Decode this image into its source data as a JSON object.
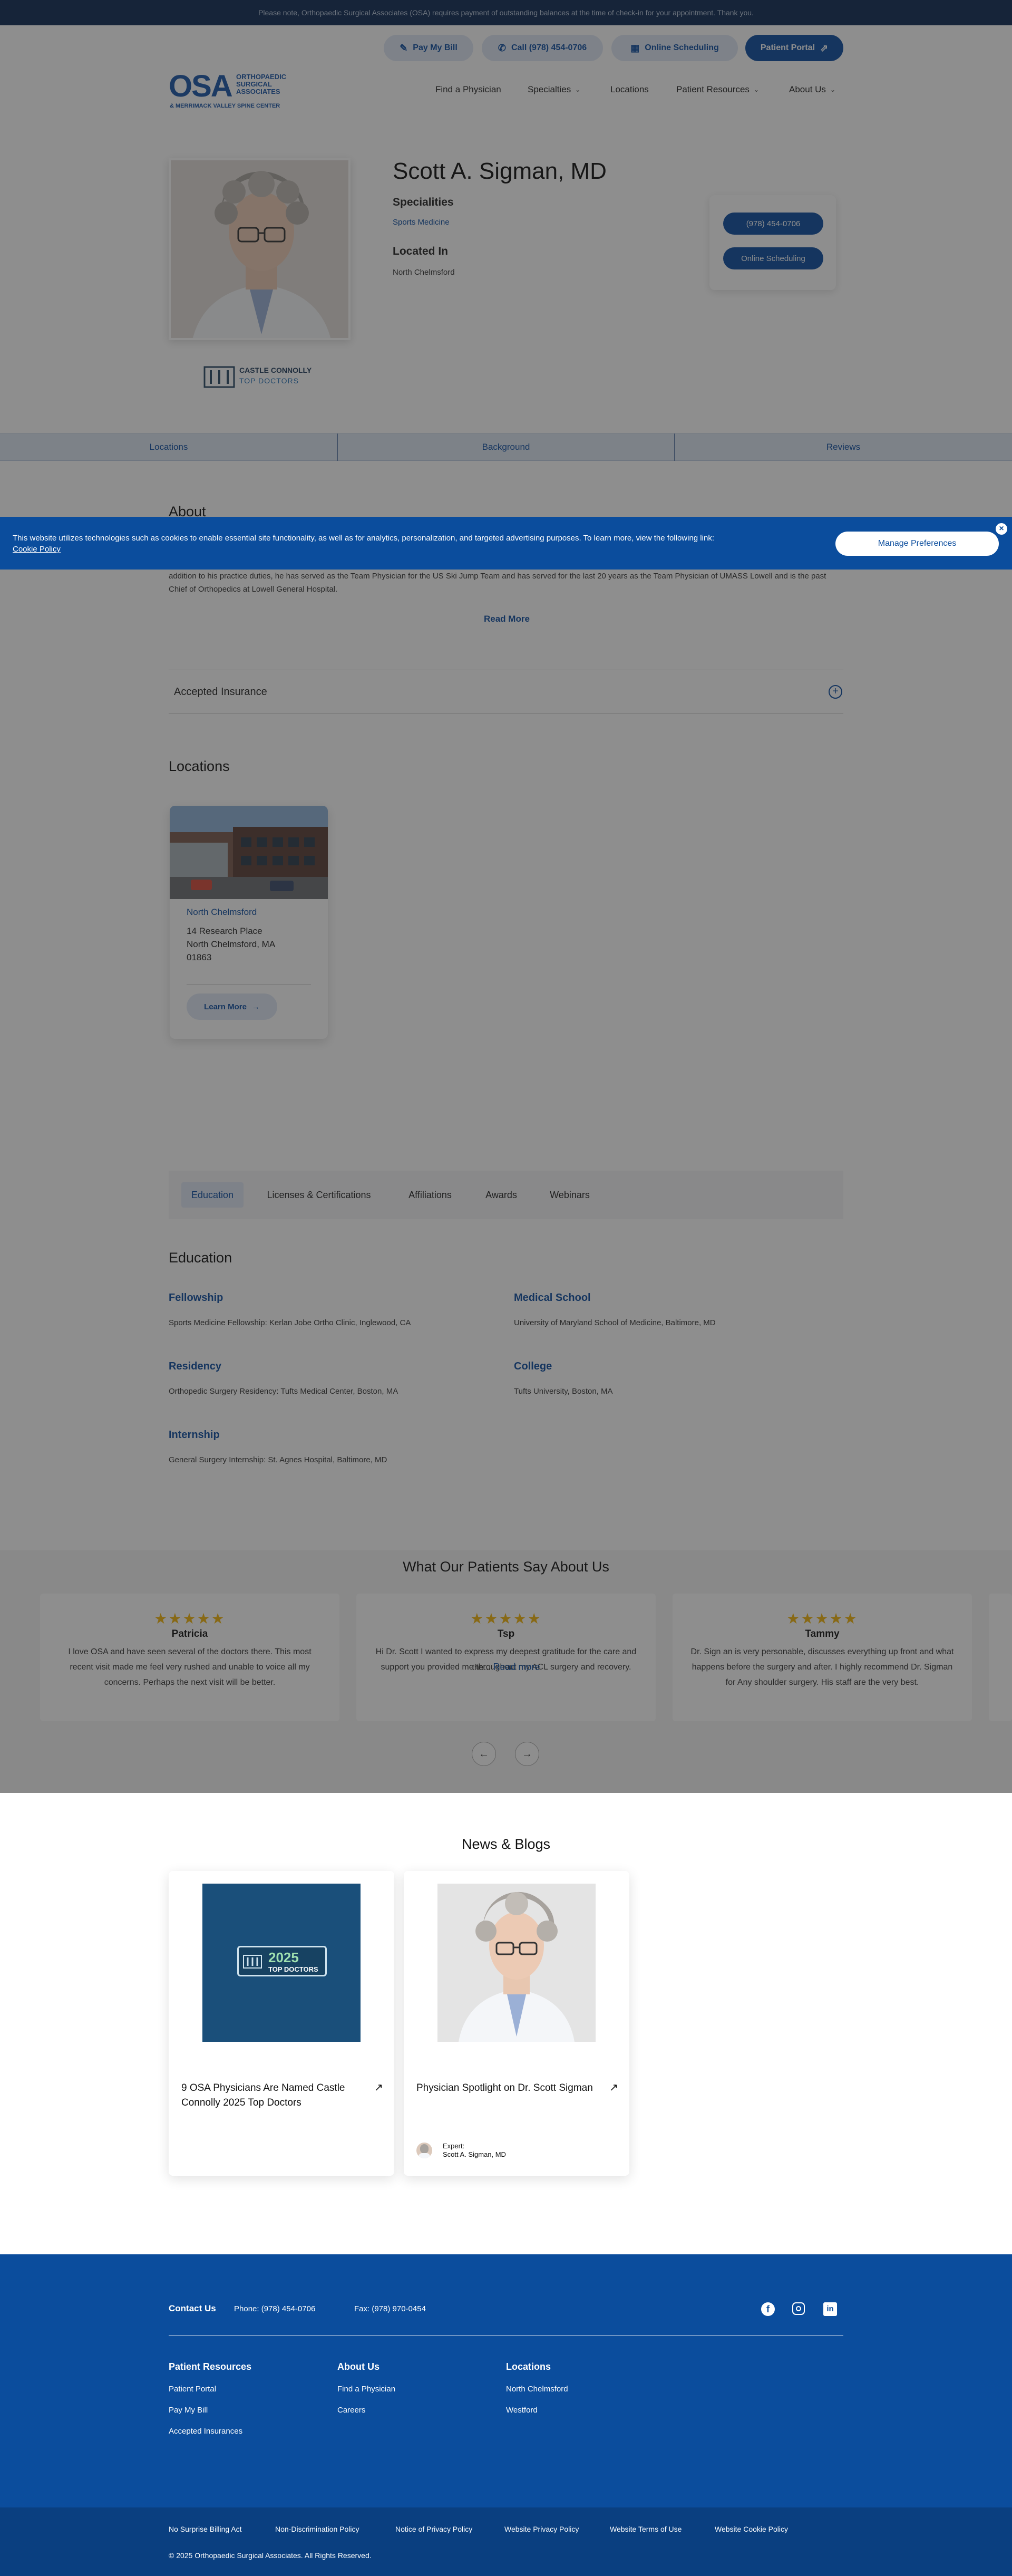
{
  "notice": {
    "text": "Please note, Orthopaedic Surgical Associates (OSA) requires payment of outstanding balances at the time of check-in for your appointment. Thank you."
  },
  "utility": {
    "pay_bill": "Pay My Bill",
    "call": "Call (978) 454-0706",
    "schedule": "Online Scheduling",
    "portal": "Patient Portal"
  },
  "logo": {
    "mark": "OSA",
    "name": "ORTHOPAEDIC SURGICAL ASSOCIATES",
    "tagline": "& MERRIMACK VALLEY SPINE CENTER"
  },
  "nav": {
    "items": [
      "Find a Physician",
      "Specialties",
      "Locations",
      "Patient Resources",
      "About Us"
    ]
  },
  "profile": {
    "name": "Scott A. Sigman, MD",
    "specialties_label": "Specialities",
    "specialty": "Sports Medicine",
    "located_label": "Located In",
    "location": "North Chelmsford",
    "phone_button": "(978) 454-0706",
    "schedule_button": "Online Scheduling",
    "award_line1": "CASTLE CONNOLLY",
    "award_line2": "TOP DOCTORS"
  },
  "tabs": [
    "Locations",
    "Background",
    "Reviews"
  ],
  "about": {
    "title": "About",
    "text": "addition to his practice duties, he has served as the Team Physician for the US Ski Jump Team and has served for the last 20 years as the Team Physician of UMASS Lowell and is the past Chief of Orthopedics at Lowell General Hospital.",
    "read_more": "Read More",
    "insurance": "Accepted Insurance"
  },
  "locations": {
    "title": "Locations",
    "card": {
      "name": "North Chelmsford",
      "line1": "14 Research Place",
      "line2": "North Chelmsford, MA",
      "line3": "01863",
      "button": "Learn More"
    }
  },
  "background": {
    "tabs": [
      "Education",
      "Licenses & Certifications",
      "Affiliations",
      "Awards",
      "Webinars"
    ],
    "title": "Education",
    "items": [
      {
        "heading": "Fellowship",
        "value": "Sports Medicine Fellowship: Kerlan Jobe Ortho Clinic, Inglewood, CA"
      },
      {
        "heading": "Medical School",
        "value": "University of Maryland School of Medicine, Baltimore, MD"
      },
      {
        "heading": "Residency",
        "value": "Orthopedic Surgery Residency: Tufts Medical Center, Boston, MA"
      },
      {
        "heading": "College",
        "value": "Tufts University, Boston, MA"
      },
      {
        "heading": "Internship",
        "value": "General Surgery Internship: St. Agnes Hospital, Baltimore, MD"
      }
    ]
  },
  "testimonials": {
    "title": "What Our Patients Say About Us",
    "stars": "★★★★★",
    "items": [
      {
        "name": "Patricia",
        "text": "I love OSA and have seen several of the doctors there. This most recent visit made me feel very rushed and unable to voice all my concerns. Perhaps the next visit will be better."
      },
      {
        "name": "Tsp",
        "text": "Hi Dr. Scott I wanted to express my deepest gratitude for the care and support you provided me throughout my ACL surgery and recovery. First I was so worry because is a revision ACL, you took the...",
        "more": "Read more"
      },
      {
        "name": "Tammy",
        "text": "Dr. Sign an is very personable, discusses everything up front and what happens before the surgery and after. I highly recommend Dr. Sigman for Any shoulder surgery. His staff are the very best."
      }
    ]
  },
  "news": {
    "title": "News & Blogs",
    "items": [
      {
        "title": "9 OSA Physicians Are Named Castle Connolly 2025 Top Doctors",
        "badge_year": "2025",
        "badge_text": "TOP DOCTORS"
      },
      {
        "title": "Physician Spotlight on Dr. Scott Sigman",
        "expert_label": "Expert:",
        "expert_name": "Scott A. Sigman, MD"
      }
    ]
  },
  "cookie": {
    "text": "This website utilizes technologies such as cookies to enable essential site functionality, as well as for analytics, personalization, and targeted advertising purposes. To learn more, view the following link:",
    "link": "Cookie Policy",
    "button": "Manage Preferences"
  },
  "footer": {
    "contact_title": "Contact Us",
    "phone": "Phone: (978) 454-0706",
    "fax": "Fax: (978) 970-0454",
    "columns": [
      {
        "title": "Patient Resources",
        "links": [
          "Patient Portal",
          "Pay My Bill",
          "Accepted Insurances"
        ]
      },
      {
        "title": "About Us",
        "links": [
          "Find a Physician",
          "Careers"
        ]
      },
      {
        "title": "Locations",
        "links": [
          "North Chelmsford",
          "Westford"
        ]
      }
    ],
    "legal_links": [
      "No Surprise Billing Act",
      "Non-Discrimination Policy",
      "Notice of Privacy Policy",
      "Website Privacy Policy",
      "Website Terms of Use",
      "Website Cookie Policy"
    ],
    "copyright": "© 2025 Orthopaedic Surgical Associates. All Rights Reserved."
  },
  "colors": {
    "brand": "#0d4da0",
    "footer": "#0b4d9d",
    "star": "#f2b50d"
  }
}
